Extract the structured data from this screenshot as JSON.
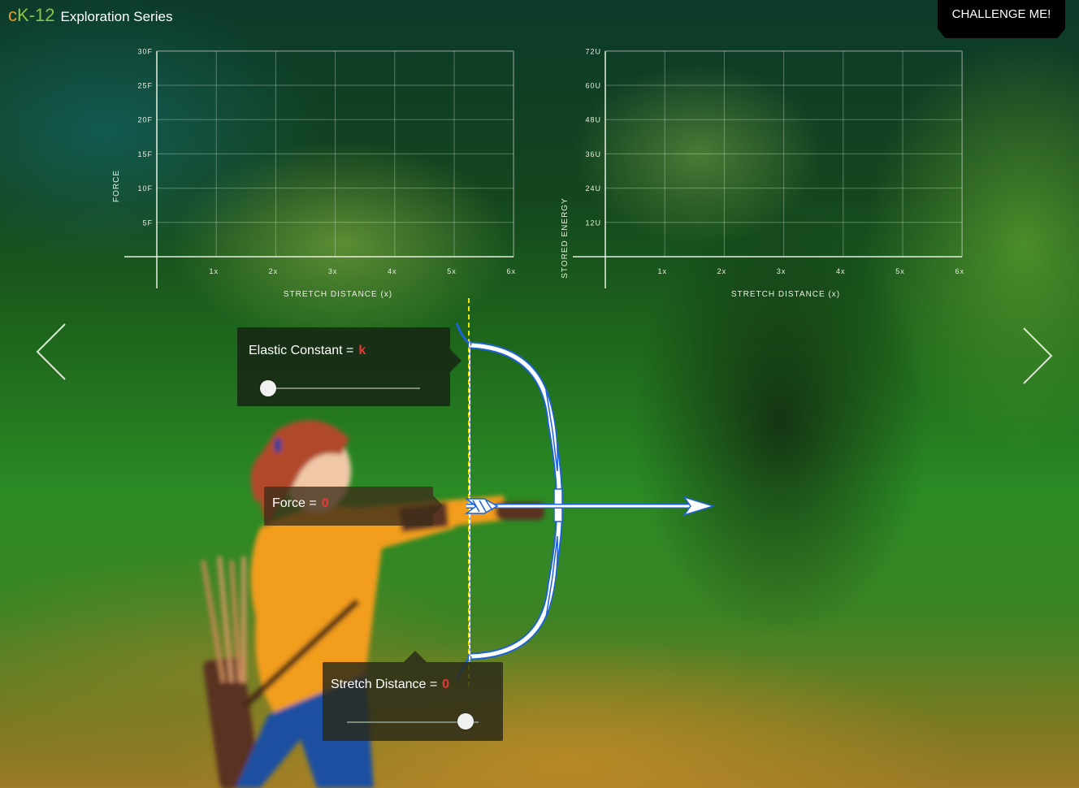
{
  "header": {
    "logo_c": "c",
    "logo_k": "K-12",
    "title": "Exploration Series",
    "challenge_label": "CHALLENGE ME!"
  },
  "force_chart": {
    "ylabel": "FORCE",
    "xlabel": "STRETCH DISTANCE (x)",
    "yticks": [
      "5F",
      "10F",
      "15F",
      "20F",
      "25F",
      "30F"
    ],
    "xticks": [
      "1x",
      "2x",
      "3x",
      "4x",
      "5x",
      "6x"
    ]
  },
  "energy_chart": {
    "ylabel": "STORED ENERGY",
    "xlabel": "STRETCH DISTANCE (x)",
    "yticks": [
      "12U",
      "24U",
      "36U",
      "48U",
      "60U",
      "72U"
    ],
    "xticks": [
      "1x",
      "2x",
      "3x",
      "4x",
      "5x",
      "6x"
    ]
  },
  "controls": {
    "elastic": {
      "label": "Elastic Constant =",
      "value": "k",
      "slider_fraction": 0.05
    },
    "force": {
      "label": "Force =",
      "value": "0"
    },
    "stretch": {
      "label": "Stretch Distance =",
      "value": "0",
      "slider_fraction": 0.9
    }
  },
  "nav": {
    "prev_icon": "chevron-left-icon",
    "next_icon": "chevron-right-icon"
  },
  "colors": {
    "value_red": "#e53935",
    "guide_yellow": "#f2e600",
    "outline_blue": "#1e63d6",
    "archer_orange": "#f29d1f"
  }
}
